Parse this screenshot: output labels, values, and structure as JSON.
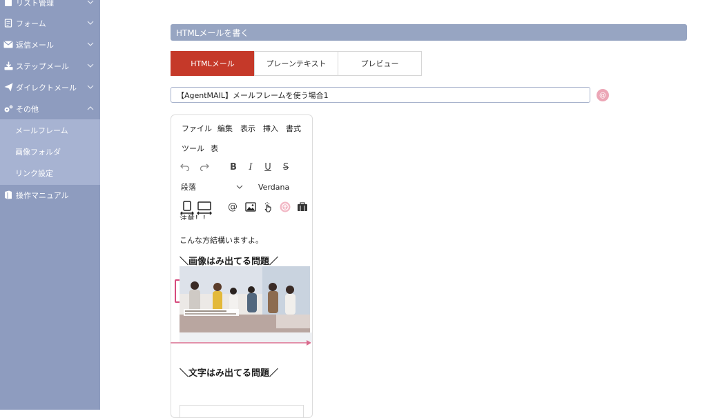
{
  "sidebar": {
    "items": [
      {
        "label": "リスト管理",
        "icon": "list-icon"
      },
      {
        "label": "フォーム",
        "icon": "form-icon"
      },
      {
        "label": "返信メール",
        "icon": "envelope-icon"
      },
      {
        "label": "ステップメール",
        "icon": "step-mail-icon"
      },
      {
        "label": "ダイレクトメール",
        "icon": "paper-plane-icon"
      },
      {
        "label": "その他",
        "icon": "gears-icon"
      }
    ],
    "submenu": [
      {
        "label": "メールフレーム"
      },
      {
        "label": "画像フォルダ"
      },
      {
        "label": "リンク設定"
      }
    ],
    "manual": {
      "label": "操作マニュアル",
      "icon": "book-icon"
    }
  },
  "main": {
    "title": "HTMLメールを書く",
    "tabs": [
      {
        "label": "HTMLメール",
        "active": true
      },
      {
        "label": "プレーンテキスト",
        "active": false
      },
      {
        "label": "プレビュー",
        "active": false
      }
    ],
    "subject_value": "【AgentMAIL】メールフレームを使う場合1",
    "at_button": "@"
  },
  "editor": {
    "menu": [
      "ファイル",
      "編集",
      "表示",
      "挿入",
      "書式",
      "ツール",
      "表"
    ],
    "block_format": "段落",
    "font": "Verdana",
    "content": {
      "cut_text": "注意！！",
      "line1": "こんな方結構いますよ。",
      "heading1": "＼画像はみ出てる問題／",
      "heading2": "＼文字はみ出てる問題／"
    }
  },
  "colors": {
    "sidebar_bg": "#8e9cbf",
    "submenu_bg": "#a7b3d2",
    "accent_red": "#c53929",
    "title_bar": "#97a5c2",
    "highlight_pink": "#d64a7c"
  }
}
